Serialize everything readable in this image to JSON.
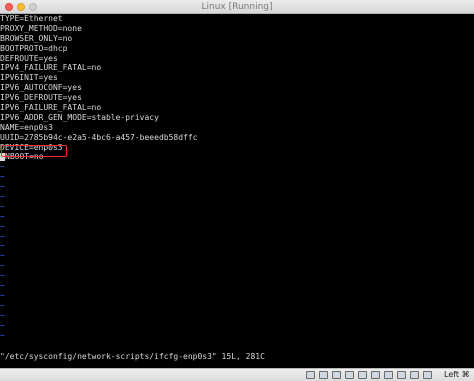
{
  "window": {
    "title": "Linux [Running]"
  },
  "terminal": {
    "lines": [
      "TYPE=Ethernet",
      "PROXY_METHOD=none",
      "BROWSER_ONLY=no",
      "BOOTPROTO=dhcp",
      "DEFROUTE=yes",
      "IPV4_FAILURE_FATAL=no",
      "IPV6INIT=yes",
      "IPV6_AUTOCONF=yes",
      "IPV6_DEFROUTE=yes",
      "IPV6_FAILURE_FATAL=no",
      "IPV6_ADDR_GEN_MODE=stable-privacy",
      "NAME=enp0s3",
      "UUID=2785b94c-e2a5-4bc6-a457-beeedb58dffc",
      "DEVICE=enp0s3"
    ],
    "cursor_line": "ONBOOT=no",
    "cursor_rest": "NBOOT=no",
    "tilde": "~",
    "empty_line_count": 18,
    "status": "\"/etc/sysconfig/network-scripts/ifcfg-enp0s3\" 15L, 281C"
  },
  "bottombar": {
    "host_key": "Left ⌘"
  },
  "colors": {
    "tilde": "#3c63ff",
    "highlight": "#ff2a2a"
  }
}
